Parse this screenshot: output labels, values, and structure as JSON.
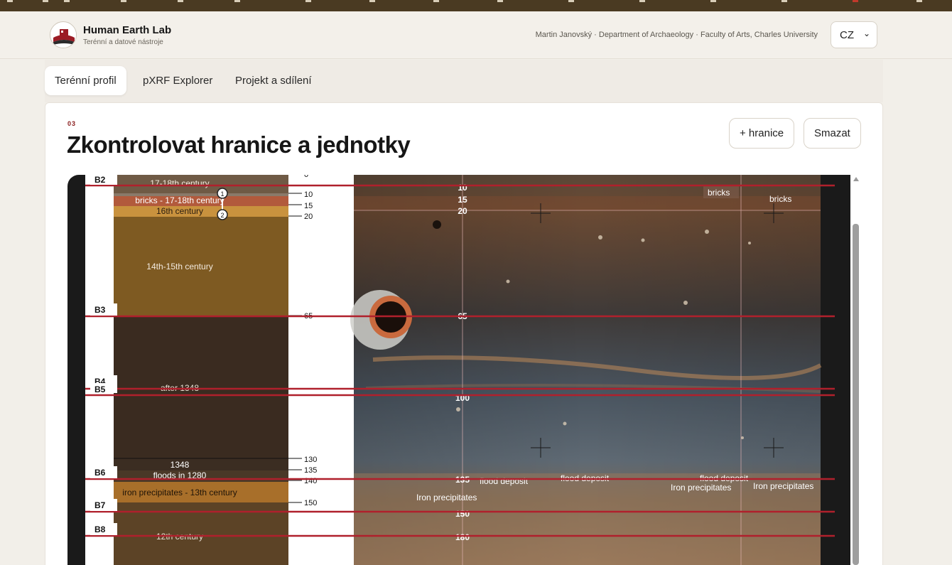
{
  "app": {
    "title": "Human Earth Lab",
    "subtitle": "Terénní a datové nástroje",
    "credit": "Martin Janovský · Department of Archaeology · Faculty of Arts, Charles University",
    "language": "CZ"
  },
  "tabs": [
    {
      "label": "Terénní profil",
      "active": true
    },
    {
      "label": "pXRF Explorer",
      "active": false
    },
    {
      "label": "Projekt a sdílení",
      "active": false
    }
  ],
  "panel": {
    "step": "03",
    "title": "Zkontrolovat hranice a jednotky",
    "add_boundary_label": "+ hranice",
    "delete_label": "Smazat"
  },
  "profile": {
    "boundaries": [
      "B2",
      "B3",
      "B4",
      "B5",
      "B6",
      "B7",
      "B8"
    ],
    "layers": [
      {
        "label": "17-18th century",
        "color": "#6f5a45"
      },
      {
        "label": "bricks - 17-18th century",
        "color": "#b25a3c"
      },
      {
        "label": "16th century",
        "color": "#c9923e"
      },
      {
        "label": "14th-15th century",
        "color": "#7e5a22"
      },
      {
        "label": "after 1348",
        "color": "#3a2b20"
      },
      {
        "label": "1348",
        "color": "#3b2d22"
      },
      {
        "label": "floods in 1280",
        "color": "#4a3827"
      },
      {
        "label": "iron precipitates - 13th century",
        "color": "#a86f2a"
      },
      {
        "label": "12th century",
        "color": "#5c4326"
      }
    ],
    "depth_ticks": [
      "0",
      "10",
      "15",
      "20",
      "65",
      "130",
      "135",
      "140",
      "150"
    ],
    "markers": [
      "1",
      "2"
    ],
    "photo_depth_labels": [
      "10",
      "15",
      "20",
      "65",
      "100",
      "135",
      "150",
      "180"
    ],
    "photo_annotations": [
      "bricks",
      "bricks",
      "flood deposit",
      "flood deposit",
      "flood deposit",
      "Iron precipitates",
      "Iron precipitates",
      "Iron precipitates"
    ],
    "boundary_color": "#b0202c"
  }
}
